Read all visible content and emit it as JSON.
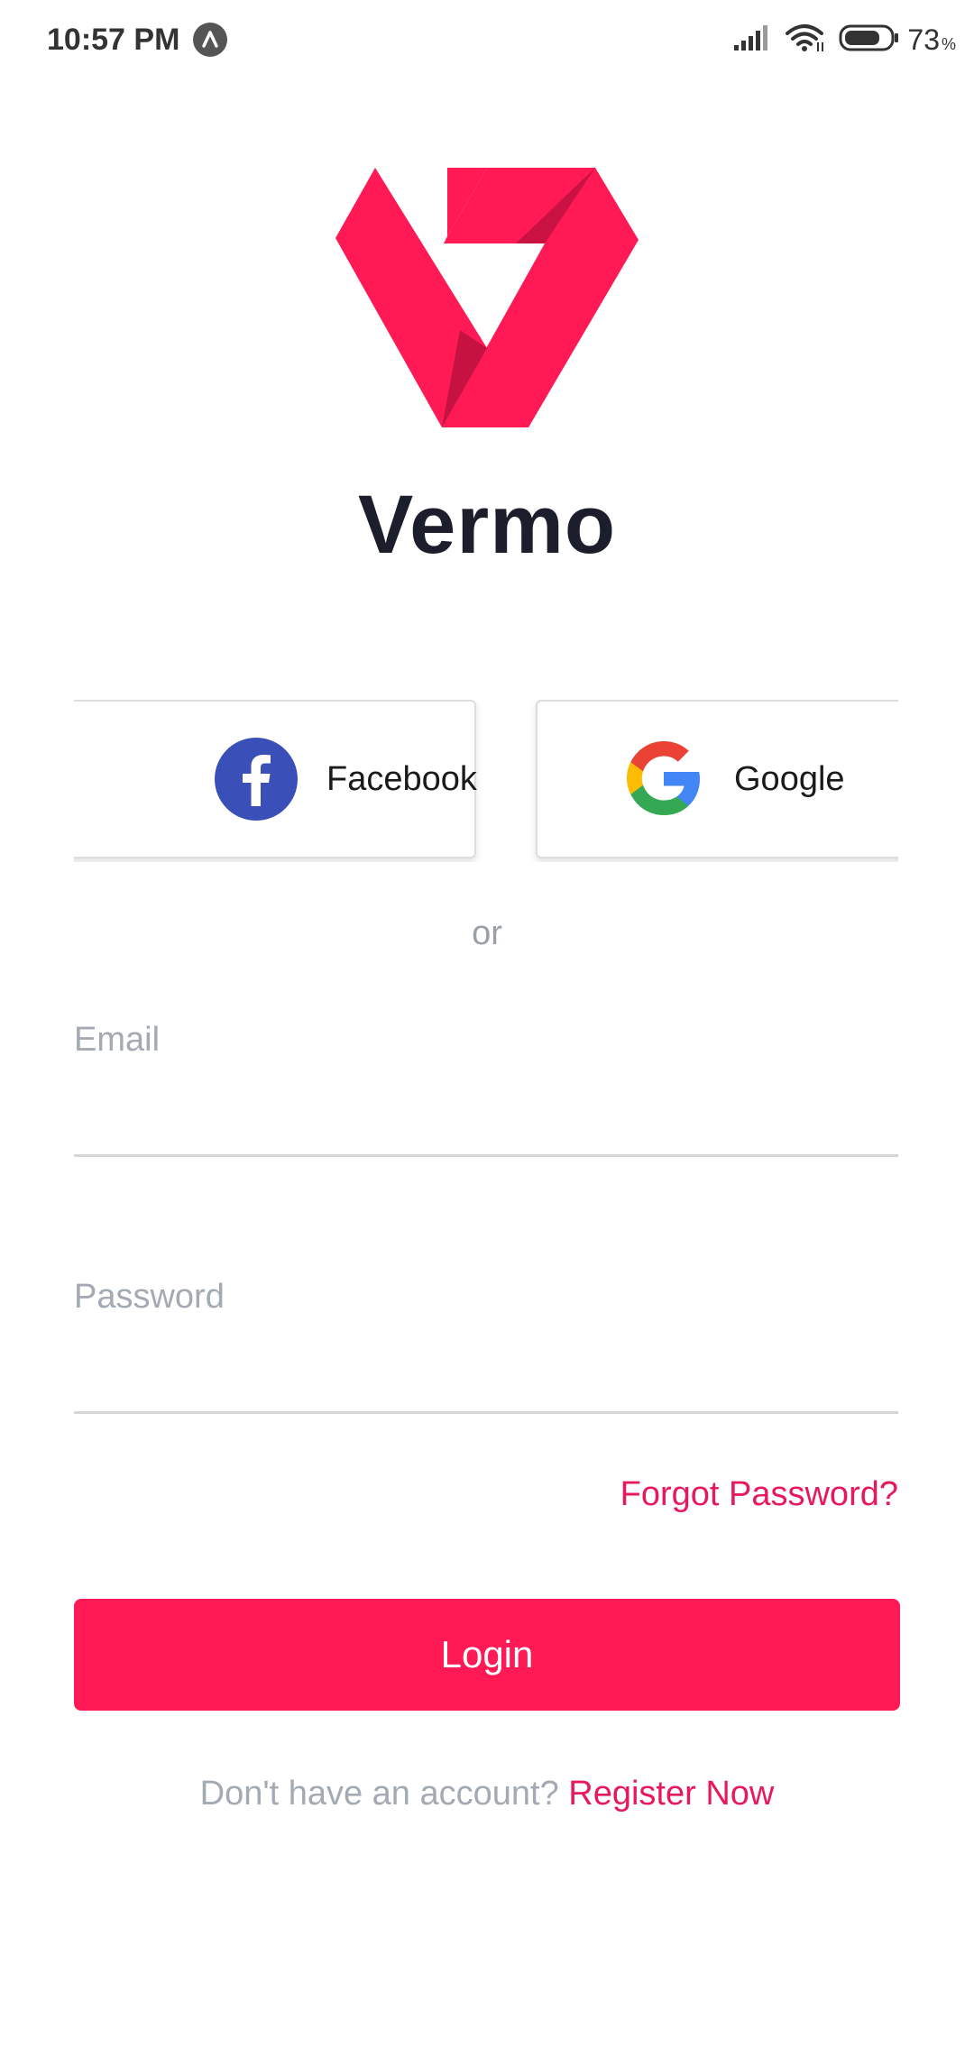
{
  "status_bar": {
    "time": "10:57 PM",
    "battery_level": "73",
    "battery_unit": "%"
  },
  "brand": {
    "name": "Vermo",
    "color": "#ff1a55"
  },
  "social": {
    "facebook_label": "Facebook",
    "google_label": "Google"
  },
  "divider_text": "or",
  "form": {
    "email_label": "Email",
    "email_value": "",
    "password_label": "Password",
    "password_value": ""
  },
  "forgot_password": "Forgot Password?",
  "login_button": "Login",
  "register": {
    "prompt": "Don't have an account?",
    "link": "Register Now"
  },
  "colors": {
    "accent": "#ff1a55",
    "link": "#e8195a",
    "muted_text": "#a3aab3",
    "title": "#1d1e2c"
  },
  "icons": {
    "status_app": "app-icon",
    "signal": "signal-icon",
    "wifi": "wifi-icon",
    "battery": "battery-icon",
    "facebook": "facebook-icon",
    "google": "google-icon",
    "logo": "vermo-logo"
  }
}
